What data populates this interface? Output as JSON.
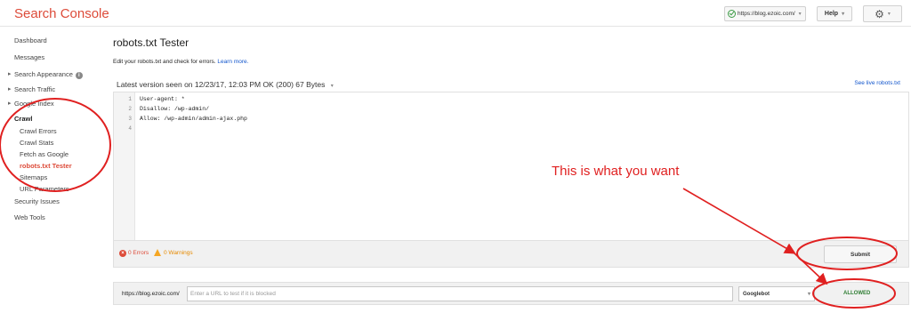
{
  "header": {
    "brand": "Search Console",
    "site": "https://blog.ezoic.com/",
    "help_label": "Help",
    "gear_icon": "gear-icon"
  },
  "sidebar": {
    "items": [
      {
        "label": "Dashboard"
      },
      {
        "label": "Messages"
      },
      {
        "label": "Search Appearance"
      },
      {
        "label": "Search Traffic"
      },
      {
        "label": "Google Index"
      },
      {
        "label": "Crawl"
      },
      {
        "label": "Crawl Errors"
      },
      {
        "label": "Crawl Stats"
      },
      {
        "label": "Fetch as Google"
      },
      {
        "label": "robots.txt Tester"
      },
      {
        "label": "Sitemaps"
      },
      {
        "label": "URL Parameters"
      },
      {
        "label": "Security Issues"
      },
      {
        "label": "Web Tools"
      }
    ]
  },
  "main": {
    "title": "robots.txt Tester",
    "intro": "Edit your robots.txt and check for errors.",
    "learn_more": "Learn more.",
    "version_line": "Latest version seen on 12/23/17, 12:03 PM OK (200) 67 Bytes",
    "see_live": "See live robots.txt",
    "editor": {
      "line_numbers": [
        "1",
        "2",
        "3",
        "4"
      ],
      "lines": [
        "User-agent: *",
        "Disallow: /wp-admin/",
        "Allow: /wp-admin/admin-ajax.php",
        ""
      ]
    },
    "status": {
      "errors": "0 Errors",
      "warnings": "0 Warnings",
      "submit_label": "Submit"
    },
    "tester": {
      "url_prefix": "https://blog.ezoic.com/",
      "placeholder": "Enter a URL to test if it is blocked",
      "bot": "Googlebot",
      "result": "ALLOWED"
    }
  },
  "annotation": {
    "text": "This is what you want",
    "color": "#e02020"
  },
  "colors": {
    "brand": "#dd4b39",
    "link": "#1155cc",
    "allowed": "#2e7d32",
    "warning": "#f5a623"
  }
}
